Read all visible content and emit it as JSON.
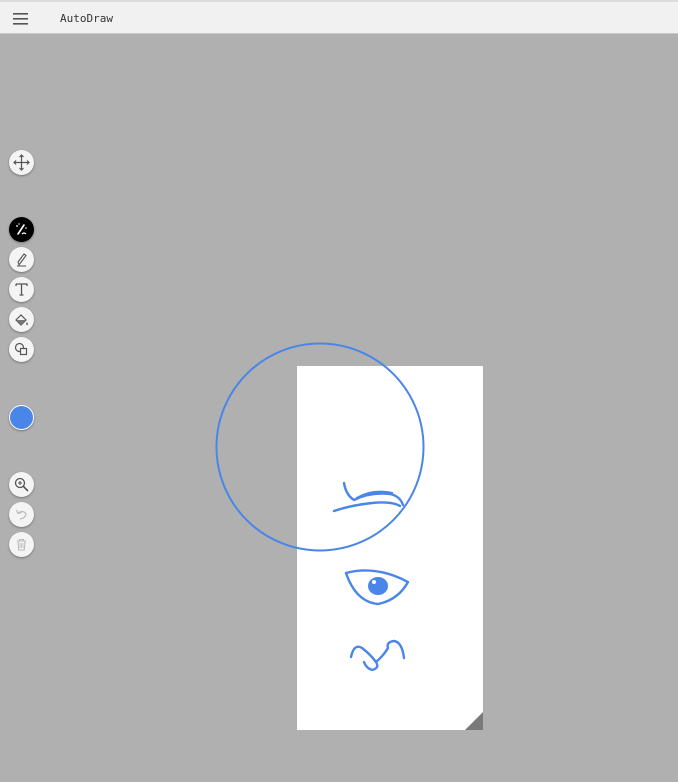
{
  "app": {
    "title": "AutoDraw"
  },
  "colors": {
    "stroke": "#4a86e8",
    "canvas_background": "#b0b0b0",
    "paper": "#ffffff",
    "active_tool": "#000000"
  },
  "toolbar": {
    "tools": [
      {
        "name": "move",
        "icon": "move-icon"
      },
      {
        "name": "autodraw",
        "icon": "autodraw-icon",
        "active": true
      },
      {
        "name": "draw",
        "icon": "pencil-icon"
      },
      {
        "name": "type",
        "icon": "text-icon"
      },
      {
        "name": "fill",
        "icon": "fill-bucket-icon"
      },
      {
        "name": "shape",
        "icon": "shape-icon"
      },
      {
        "name": "color",
        "icon": "color-swatch",
        "value": "#4a86e8"
      },
      {
        "name": "zoom",
        "icon": "zoom-in-icon"
      },
      {
        "name": "undo",
        "icon": "undo-icon",
        "disabled": true
      },
      {
        "name": "delete",
        "icon": "trash-icon",
        "disabled": true
      }
    ]
  }
}
